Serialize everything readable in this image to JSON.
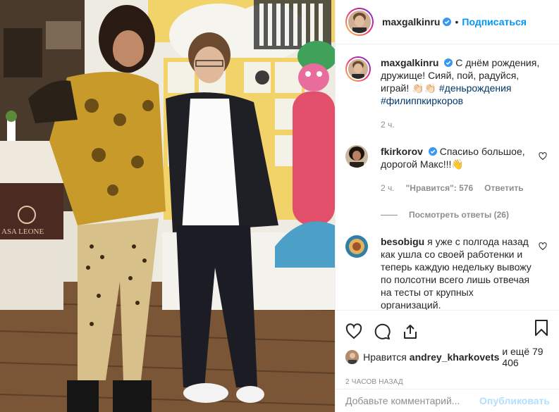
{
  "header": {
    "username": "maxgalkinru",
    "verified": true,
    "separator": "•",
    "follow_label": "Подписаться"
  },
  "caption": {
    "username": "maxgalkinru",
    "text": "С днём рождения, дружище! Сияй, пой, радуйся, играй! 👏🏻👏🏻 ",
    "hashtags": [
      "#деньрождения",
      "#филиппкиркоров"
    ],
    "time": "2 ч."
  },
  "comments": [
    {
      "username": "fkirkorov",
      "verified": true,
      "text": "Спасиьо большое, дорогой Макс!!!👋",
      "time": "2 ч.",
      "likes": "\"Нравится\": 576",
      "reply_label": "Ответить",
      "view_replies": "Посмотреть ответы (26)"
    },
    {
      "username": "besobigu",
      "text": "я уже с полгода назад как ушла со своей работенки и теперь каждую недельку вывожу по полсотни всего лишь отвечая на тесты от крупных организаций."
    }
  ],
  "actions": {
    "like_icon": "heart-icon",
    "comment_icon": "comment-icon",
    "share_icon": "share-icon",
    "save_icon": "bookmark-icon"
  },
  "likes": {
    "prefix": "Нравится",
    "user": "andrey_kharkovets",
    "suffix": "и ещё 79 406"
  },
  "timestamp": "2 ЧАСОВ НАЗАД",
  "add_comment": {
    "placeholder": "Добавьте комментарий...",
    "publish_label": "Опубликовать"
  },
  "photo": {
    "sign_text": "ASA LEONE",
    "colors": {
      "wall": "#e9e6dc",
      "floor": "#6b4a2f",
      "yellow": "#f1d36a"
    }
  },
  "colors": {
    "accent": "#0095f6",
    "hashtag": "#00376b",
    "muted": "#8e8e8e"
  }
}
